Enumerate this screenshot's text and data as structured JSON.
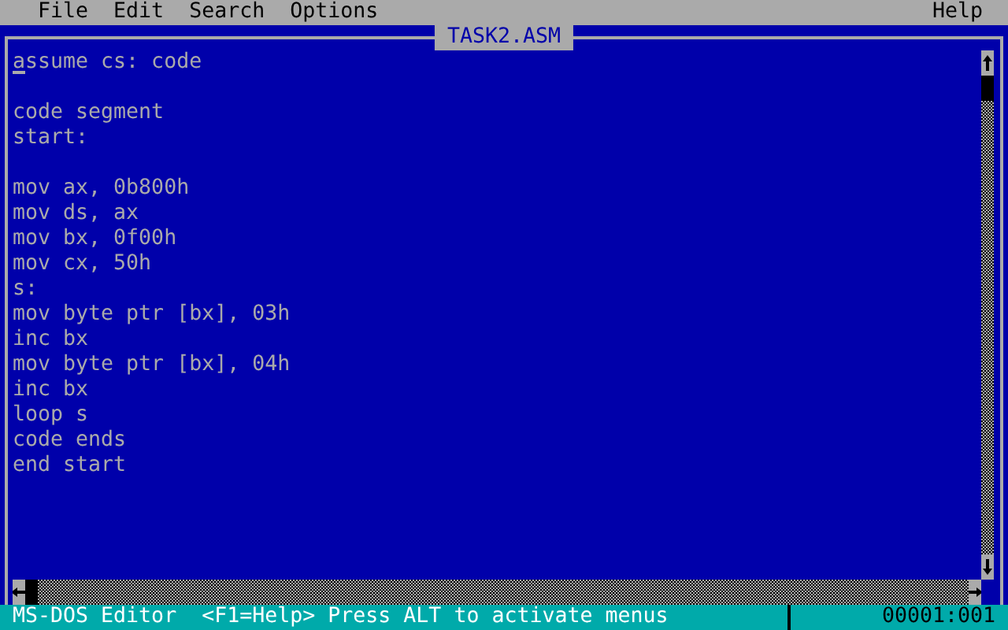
{
  "menu": [
    {
      "label": "File"
    },
    {
      "label": "Edit"
    },
    {
      "label": "Search"
    },
    {
      "label": "Options"
    },
    {
      "label": "Help",
      "kind": "right"
    }
  ],
  "editor": {
    "title": "TASK2.ASM",
    "cursor_visible": true,
    "lines": [
      {
        "kind": "code",
        "text": "assume cs: code"
      },
      {
        "kind": "blank"
      },
      {
        "kind": "code",
        "text": "code segment"
      },
      {
        "kind": "code",
        "text": "start:"
      },
      {
        "kind": "blank"
      },
      {
        "kind": "code",
        "text": "mov ax, 0b800h"
      },
      {
        "kind": "code",
        "text": "mov ds, ax"
      },
      {
        "kind": "code",
        "text": "mov bx, 0f00h"
      },
      {
        "kind": "code",
        "text": "mov cx, 50h"
      },
      {
        "kind": "code",
        "text": "s:"
      },
      {
        "kind": "code",
        "text": "mov byte ptr [bx], 03h"
      },
      {
        "kind": "code",
        "text": "inc bx"
      },
      {
        "kind": "code",
        "text": "mov byte ptr [bx], 04h"
      },
      {
        "kind": "code",
        "text": "inc bx"
      },
      {
        "kind": "code",
        "text": "loop s"
      },
      {
        "kind": "code",
        "text": "code ends"
      },
      {
        "kind": "code",
        "text": "end start"
      }
    ]
  },
  "status_bar": {
    "message": "MS-DOS Editor  <F1=Help> Press ALT to activate menus",
    "position": "00001:001"
  }
}
